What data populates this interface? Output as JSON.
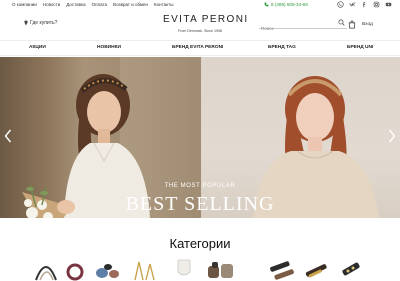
{
  "topbar": {
    "links": [
      "О компании",
      "Новости",
      "Доставка",
      "Оплата",
      "Возврат и обмен",
      "Контакты"
    ],
    "phone": "8 (499) 508-34-69",
    "social_icons": [
      "viber-icon",
      "vk-icon",
      "facebook-icon",
      "instagram-icon",
      "youtube-icon"
    ]
  },
  "header": {
    "where_to_buy": "Где купить?",
    "logo": "EVITA PERONI",
    "tagline": "From Denmark. Since 1998",
    "search_placeholder": "Поиск",
    "login": "Вход"
  },
  "nav": {
    "items": [
      "АКЦИИ",
      "НОВИНКИ",
      "БРЕНД EVITA PERONI",
      "БРЕНД TAG",
      "БРЕНД UNI"
    ]
  },
  "hero": {
    "kicker": "THE MOST POPULAR",
    "title": "BEST SELLING"
  },
  "categories": {
    "title": "Категории"
  },
  "colors": {
    "accent_green": "#2e9a3c",
    "text": "#222222"
  }
}
